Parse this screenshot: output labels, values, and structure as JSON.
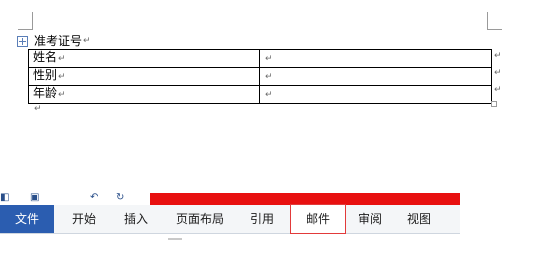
{
  "document": {
    "title": "准考证号",
    "para_mark": "↵",
    "table": {
      "rows": [
        {
          "label": "姓名",
          "value": ""
        },
        {
          "label": "性别",
          "value": ""
        },
        {
          "label": "年龄",
          "value": ""
        }
      ]
    }
  },
  "ribbon": {
    "tabs": [
      "文件",
      "开始",
      "插入",
      "页面布局",
      "引用",
      "邮件",
      "审阅",
      "视图"
    ],
    "highlighted_tab": "邮件",
    "colors": {
      "file_tab_bg": "#2b5db0",
      "highlight_border": "#e23a3a",
      "title_strip": "#e81010"
    }
  }
}
